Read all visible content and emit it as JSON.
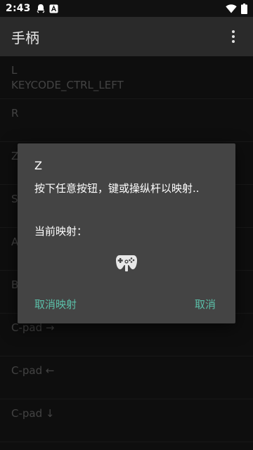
{
  "status_bar": {
    "time": "2:43",
    "left_icons": [
      "notification-icon",
      "app-notification-icon"
    ],
    "right_icons": [
      "wifi-icon",
      "battery-icon"
    ]
  },
  "app_bar": {
    "title": "手柄",
    "menu_icon": "overflow-menu-icon"
  },
  "list": {
    "items": [
      {
        "label": "L",
        "value": "KEYCODE_CTRL_LEFT"
      },
      {
        "label": "R",
        "value": ""
      },
      {
        "label": "Z",
        "value": ""
      },
      {
        "label": "S",
        "value": ""
      },
      {
        "label": "A",
        "value": ""
      },
      {
        "label": "B",
        "value": ""
      },
      {
        "label": "C-pad →",
        "value": ""
      },
      {
        "label": "C-pad ←",
        "value": ""
      },
      {
        "label": "C-pad ↓",
        "value": ""
      }
    ]
  },
  "dialog": {
    "title": "Z",
    "message": "按下任意按钮，键或操纵杆以映射..",
    "current_mapping_label": "当前映射：",
    "controller_icon": "gamepad-icon",
    "unmap_button": "取消映射",
    "cancel_button": "取消",
    "button_color": "#5bbfa8"
  }
}
